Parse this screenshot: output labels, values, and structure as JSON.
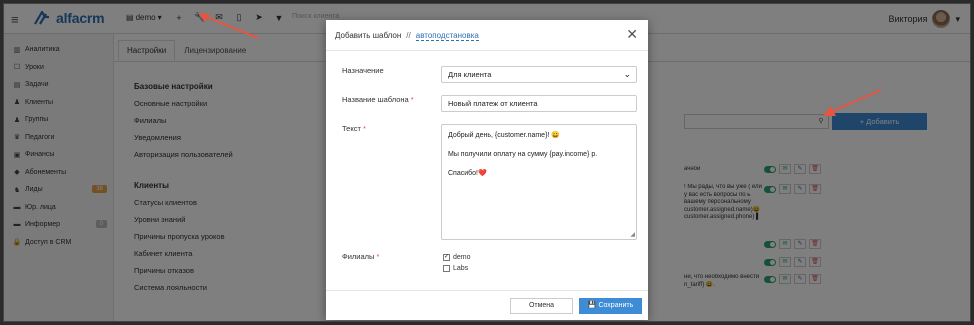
{
  "app": {
    "brand": "alfacrm",
    "branch_selector": "demo",
    "search_placeholder": "Поиск клиента",
    "user_name": "Виктория"
  },
  "icons": {
    "menu": "hamburger-icon",
    "toolbar": [
      "plus-icon",
      "wrench-icon",
      "mail-icon",
      "phone-icon",
      "send-icon",
      "filter-icon"
    ]
  },
  "sidebar": {
    "items": [
      {
        "label": "Аналитика",
        "icon": "chart-icon"
      },
      {
        "label": "Уроки",
        "icon": "calendar-icon"
      },
      {
        "label": "Задачи",
        "icon": "tasks-icon"
      },
      {
        "label": "Клиенты",
        "icon": "user-icon"
      },
      {
        "label": "Группы",
        "icon": "group-icon"
      },
      {
        "label": "Педагоги",
        "icon": "teacher-icon"
      },
      {
        "label": "Финансы",
        "icon": "money-icon"
      },
      {
        "label": "Абонементы",
        "icon": "tag-icon"
      },
      {
        "label": "Лиды",
        "icon": "leads-icon",
        "badge": "38"
      },
      {
        "label": "Юр. лица",
        "icon": "briefcase-icon"
      },
      {
        "label": "Информер",
        "icon": "informer-icon",
        "badge": "0"
      },
      {
        "label": "Доступ в CRM",
        "icon": "lock-icon"
      }
    ]
  },
  "main": {
    "tabs": [
      {
        "label": "Настройки"
      },
      {
        "label": "Лицензирование"
      }
    ],
    "sections": [
      {
        "title": "Базовые настройки",
        "links": [
          "Основные настройки",
          "Филиалы",
          "Уведомления",
          "Авторизация пользователей"
        ]
      },
      {
        "title": "Клиенты",
        "links": [
          "Статусы клиентов",
          "Уровни знаний",
          "Причины пропуска уроков",
          "Кабинет клиента",
          "Причины отказов",
          "Система лояльности"
        ]
      }
    ],
    "add_button": "+ Добавить",
    "template_rows": [
      "ачной",
      "! Мы рады, что вы уже ( ели у вас есть вопросы по ь вашему персональному customer.assigned.name)😀 customer.assigned.phone) ▌",
      "",
      "",
      "ни, что необходимо внести n_tariff} 😀."
    ]
  },
  "modal": {
    "title": "Добавить шаблон",
    "separator": "//",
    "link": "автоподстановка",
    "fields": {
      "purpose_label": "Назначение",
      "purpose_value": "Для клиента",
      "name_label": "Название шаблона",
      "name_value": "Новый платеж от клиента",
      "text_label": "Текст",
      "text_lines": [
        "Добрый день, {customer.name}! 😀",
        "Мы получили оплату на сумму {pay.income} р.",
        "Спасибо!❤️"
      ],
      "branches_label": "Филиалы",
      "branches": [
        {
          "label": "demo",
          "checked": true
        },
        {
          "label": "Labs",
          "checked": false
        }
      ]
    },
    "cancel": "Отмена",
    "save": "Сохранить"
  },
  "colors": {
    "accent": "#3e8bd6",
    "brand": "#2d6fb3",
    "arrow": "#e8543f"
  }
}
